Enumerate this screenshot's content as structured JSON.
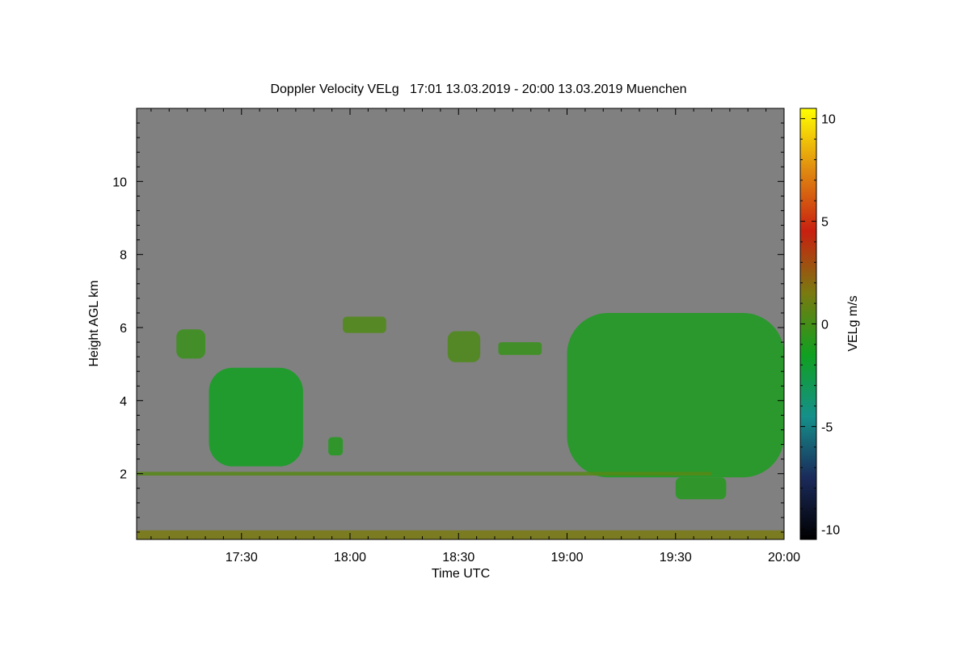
{
  "chart_data": {
    "type": "heatmap",
    "title": "Doppler Velocity VELg   17:01 13.03.2019 - 20:00 13.03.2019 Muenchen",
    "xlabel": "Time UTC",
    "ylabel": "Height AGL km",
    "colorbar_label": "VELg m/s",
    "x_range": [
      "17:01",
      "20:00"
    ],
    "x_ticks": [
      "17:30",
      "18:00",
      "18:30",
      "19:00",
      "19:30",
      "20:00"
    ],
    "ylim": [
      0.2,
      12.0
    ],
    "y_ticks": [
      2,
      4,
      6,
      8,
      10
    ],
    "colorbar_range": [
      -10.5,
      10.5
    ],
    "colorbar_ticks": [
      -10,
      -5,
      0,
      5,
      10
    ],
    "background_color": "#808080",
    "colormap": [
      "#000000",
      "#1a2a5a",
      "#15908a",
      "#10a020",
      "#7a7a10",
      "#c82010",
      "#e08a10",
      "#ffff00"
    ],
    "echo_regions": [
      {
        "name": "cloud-1722",
        "t_start": "17:12",
        "t_end": "17:20",
        "h_min": 5.15,
        "h_max": 5.95,
        "velocity": -0.3
      },
      {
        "name": "cloud-1730-lower",
        "t_start": "17:21",
        "t_end": "17:47",
        "h_min": 2.2,
        "h_max": 4.9,
        "velocity": -1.5
      },
      {
        "name": "cloud-1800-small",
        "t_start": "17:54",
        "t_end": "17:58",
        "h_min": 2.5,
        "h_max": 3.0,
        "velocity": -1.0
      },
      {
        "name": "cloud-1803",
        "t_start": "17:58",
        "t_end": "18:10",
        "h_min": 5.85,
        "h_max": 6.3,
        "velocity": 0.3
      },
      {
        "name": "cloud-1830",
        "t_start": "18:27",
        "t_end": "18:36",
        "h_min": 5.05,
        "h_max": 5.9,
        "velocity": 0.2
      },
      {
        "name": "cloud-1845",
        "t_start": "18:41",
        "t_end": "18:53",
        "h_min": 5.25,
        "h_max": 5.6,
        "velocity": -0.4
      },
      {
        "name": "cloud-1900-system",
        "t_start": "19:00",
        "t_end": "20:00",
        "h_min": 1.9,
        "h_max": 6.4,
        "velocity": -1.2
      },
      {
        "name": "cloud-1935-lower",
        "t_start": "19:30",
        "t_end": "19:44",
        "h_min": 1.3,
        "h_max": 1.9,
        "velocity": -1.0
      },
      {
        "name": "surface-clutter",
        "t_start": "17:01",
        "t_end": "20:00",
        "h_min": 0.2,
        "h_max": 0.45,
        "velocity": 1.5
      },
      {
        "name": "layer-2km",
        "t_start": "17:01",
        "t_end": "19:40",
        "h_min": 1.95,
        "h_max": 2.05,
        "velocity": 0.5
      }
    ]
  }
}
